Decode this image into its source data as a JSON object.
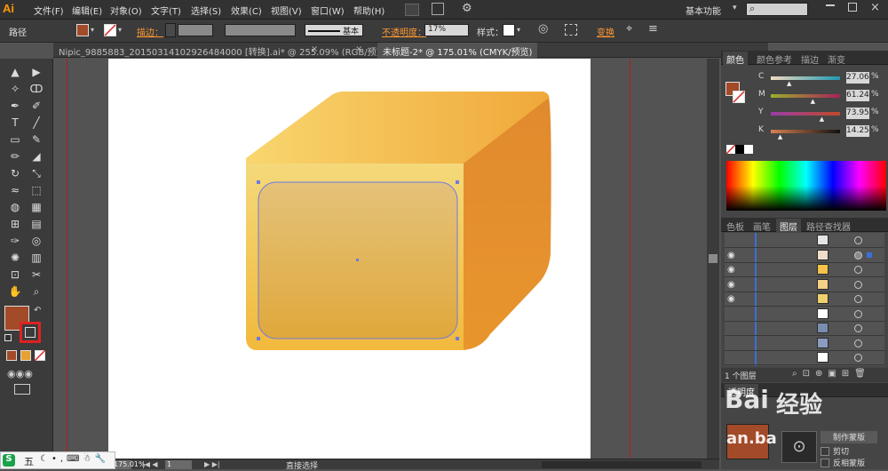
{
  "app": {
    "logo": "Ai",
    "workspace": "基本功能",
    "search_placeholder": ""
  },
  "menu": [
    "文件(F)",
    "编辑(E)",
    "对象(O)",
    "文字(T)",
    "选择(S)",
    "效果(C)",
    "视图(V)",
    "窗口(W)",
    "帮助(H)"
  ],
  "control": {
    "selection_label": "路径",
    "stroke_label": "描边：",
    "brush_label": "基本",
    "opacity_label": "不透明度：",
    "opacity_value": "17%",
    "style_label": "样式：",
    "transform_label": "变换"
  },
  "tabs": [
    {
      "label": "Nipic_9885883_20150314102926484000 [转换].ai* @ 255.09% (RGB/预览)",
      "active": false
    },
    {
      "label": "未标题-2* @ 175.01% (CMYK/预览)",
      "active": true
    }
  ],
  "colors": {
    "fill": "#a34a28",
    "cube_top_light": "#f8d66e",
    "cube_top_dark": "#f0a83a",
    "cube_side": "#e8952d",
    "cube_front": "#f3c254",
    "panel_rect": "#e2b86a",
    "selection": "#5a6bd8"
  },
  "tools": [
    [
      "selection-tool",
      "▲",
      "direct-selection-tool",
      "▶"
    ],
    [
      "magic-wand-tool",
      "✧",
      "lasso-tool",
      "ↀ"
    ],
    [
      "pen-tool",
      "✒",
      "curvature-tool",
      "✐"
    ],
    [
      "type-tool",
      "T",
      "line-tool",
      "╱"
    ],
    [
      "rectangle-tool",
      "▭",
      "paintbrush-tool",
      "✎"
    ],
    [
      "pencil-tool",
      "✏",
      "eraser-tool",
      "◢"
    ],
    [
      "rotate-tool",
      "↻",
      "scale-tool",
      "⤡"
    ],
    [
      "warp-tool",
      "≈",
      "free-transform-tool",
      "⬚"
    ],
    [
      "shape-builder-tool",
      "◍",
      "perspective-grid-tool",
      "▦"
    ],
    [
      "mesh-tool",
      "⊞",
      "gradient-tool",
      "▤"
    ],
    [
      "eyedropper-tool",
      "✑",
      "blend-tool",
      "◎"
    ],
    [
      "symbol-sprayer-tool",
      "✺",
      "column-graph-tool",
      "▥"
    ],
    [
      "artboard-tool",
      "⊡",
      "slice-tool",
      "✂"
    ],
    [
      "hand-tool",
      "✋",
      "zoom-tool",
      "⌕"
    ]
  ],
  "status": {
    "zoom": "175.01%",
    "page": "1",
    "tool_name": "直接选择"
  },
  "color_panel": {
    "tabs": [
      "颜色",
      "颜色参考",
      "描边",
      "渐变"
    ],
    "channels": [
      {
        "name": "C",
        "value": "27.06",
        "pos": 0.27
      },
      {
        "name": "M",
        "value": "61.24",
        "pos": 0.61
      },
      {
        "name": "Y",
        "value": "73.95",
        "pos": 0.74
      },
      {
        "name": "K",
        "value": "14.25",
        "pos": 0.14
      }
    ]
  },
  "layers_panel": {
    "tabs": [
      "色板",
      "画笔",
      "图层",
      "路径查找器"
    ],
    "count_label": "1 个图层",
    "rows": [
      {
        "eye": false,
        "thumb": "#e4e4e4",
        "target_active": false
      },
      {
        "eye": true,
        "thumb": "#f0ddc8",
        "target_active": true
      },
      {
        "eye": true,
        "thumb": "#f7c24a",
        "target_active": false
      },
      {
        "eye": true,
        "thumb": "#f4d088",
        "target_active": false
      },
      {
        "eye": true,
        "thumb": "#efcf6c",
        "target_active": false
      },
      {
        "eye": false,
        "thumb": "#ffffff",
        "target_active": false
      },
      {
        "eye": false,
        "thumb": "#7a8db0",
        "target_active": false
      },
      {
        "eye": false,
        "thumb": "#8a9cc0",
        "target_active": false
      },
      {
        "eye": false,
        "thumb": "#ffffff",
        "target_active": false
      }
    ]
  },
  "transparency_panel": {
    "tab": "透明度",
    "btn_mask": "制作蒙版",
    "clip_label": "剪切",
    "invert_label": "反相蒙版"
  },
  "ime": {
    "label": "五"
  },
  "watermark": {
    "text1": "Bai",
    "text2": "经验",
    "text3": "an.ba"
  }
}
